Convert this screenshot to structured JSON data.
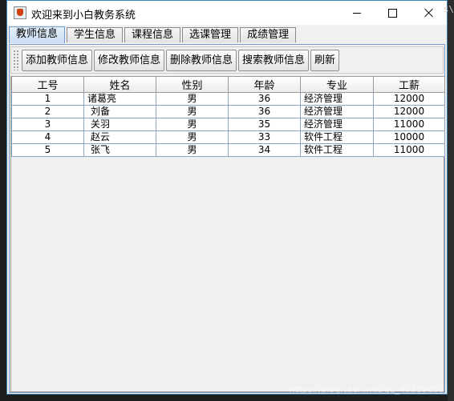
{
  "window": {
    "title": "欢迎来到小白教务系统"
  },
  "tabs": [
    {
      "label": "教师信息",
      "active": true
    },
    {
      "label": "学生信息",
      "active": false
    },
    {
      "label": "课程信息",
      "active": false
    },
    {
      "label": "选课管理",
      "active": false
    },
    {
      "label": "成绩管理",
      "active": false
    }
  ],
  "toolbar": {
    "add_label": "添加教师信息",
    "edit_label": "修改教师信息",
    "delete_label": "删除教师信息",
    "search_label": "搜索教师信息",
    "refresh_label": "刷新"
  },
  "table": {
    "columns": [
      "工号",
      "姓名",
      "性别",
      "年龄",
      "专业",
      "工薪"
    ],
    "rows": [
      [
        "1",
        "诸葛亮",
        "男",
        "36",
        "经济管理",
        "12000"
      ],
      [
        "2",
        "刘备",
        "男",
        "36",
        "经济管理",
        "12000"
      ],
      [
        "3",
        "关羽",
        "男",
        "35",
        "经济管理",
        "11000"
      ],
      [
        "4",
        "赵云",
        "男",
        "33",
        "软件工程",
        "10000"
      ],
      [
        "5",
        "张飞",
        "男",
        "34",
        "软件工程",
        "11000"
      ]
    ]
  },
  "watermark": "https://blog.csdn.net/qq_40559855",
  "edge_text": "s\\"
}
